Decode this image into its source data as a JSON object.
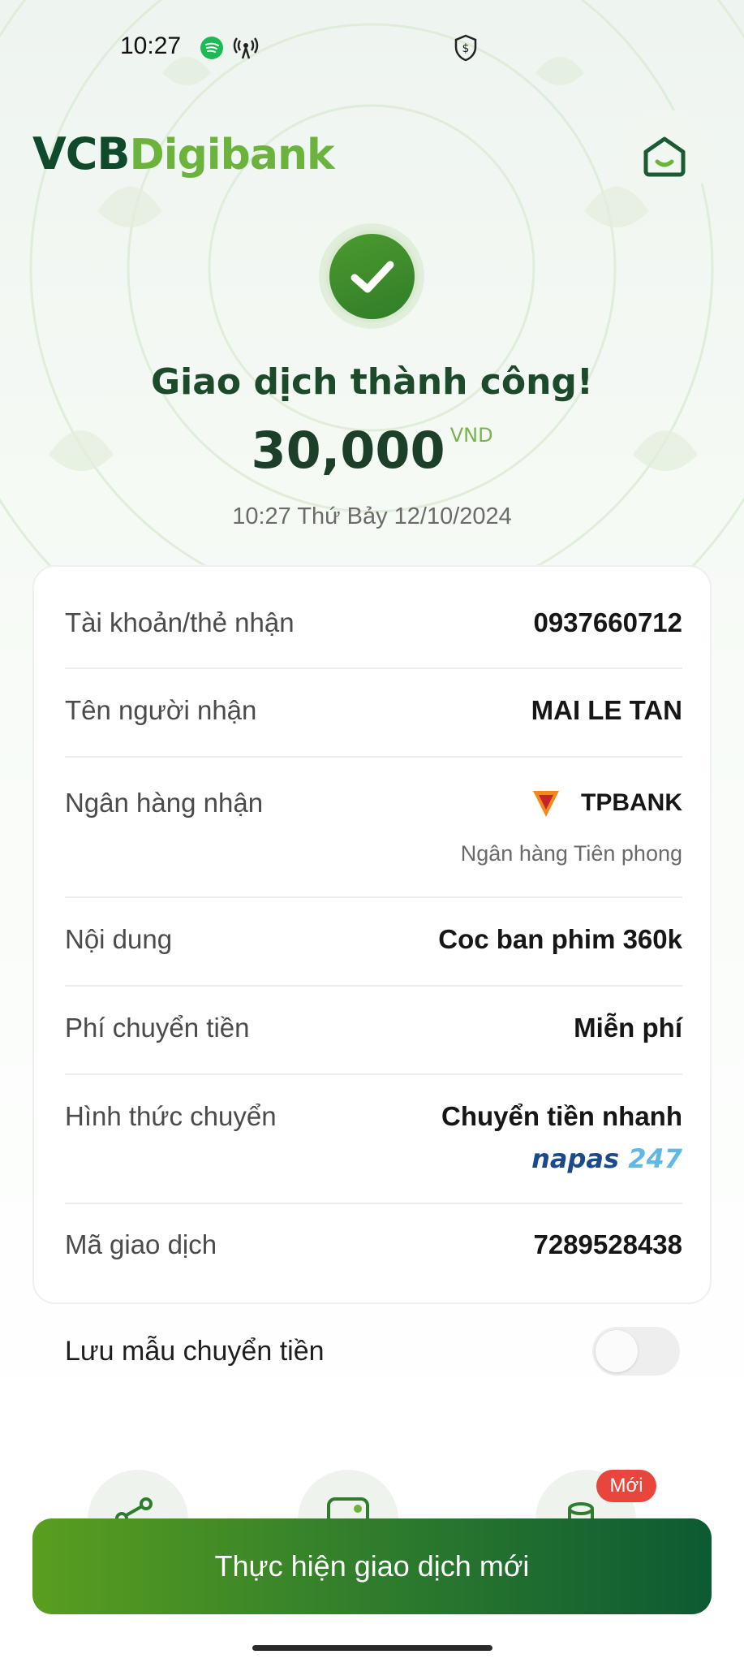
{
  "status_bar": {
    "time": "10:27",
    "icons": [
      "spotify-icon",
      "hotspot-icon",
      "shield-dollar-icon"
    ]
  },
  "header": {
    "logo_part1": "VCB",
    "logo_part2": "Digibank",
    "home_icon": "home-icon"
  },
  "result": {
    "title": "Giao dịch thành công!",
    "amount": "30,000",
    "currency": "VND",
    "datetime": "10:27 Thứ Bảy 12/10/2024"
  },
  "details": {
    "account": {
      "label": "Tài khoản/thẻ nhận",
      "value": "0937660712"
    },
    "recipient": {
      "label": "Tên người nhận",
      "value": "MAI LE TAN"
    },
    "bank": {
      "label": "Ngân hàng nhận",
      "value": "TPBANK",
      "sub": "Ngân hàng Tiên phong"
    },
    "content": {
      "label": "Nội dung",
      "value": "Coc ban phim 360k"
    },
    "fee": {
      "label": "Phí chuyển tiền",
      "value": "Miễn phí"
    },
    "method": {
      "label": "Hình thức chuyển",
      "value": "Chuyển tiền nhanh",
      "napas_text": "napas",
      "napas_num": "247"
    },
    "transaction_id": {
      "label": "Mã giao dịch",
      "value": "7289528438"
    }
  },
  "save_template": {
    "label": "Lưu mẫu chuyển tiền",
    "enabled": false
  },
  "shortcuts": {
    "new_badge": "Mới"
  },
  "cta": {
    "label": "Thực hiện giao dịch mới"
  },
  "colors": {
    "brand_dark": "#0e4a2b",
    "brand_green": "#6cb33e",
    "cta_start": "#5a9e1f",
    "cta_end": "#0d5a33",
    "badge_red": "#e8453c"
  }
}
